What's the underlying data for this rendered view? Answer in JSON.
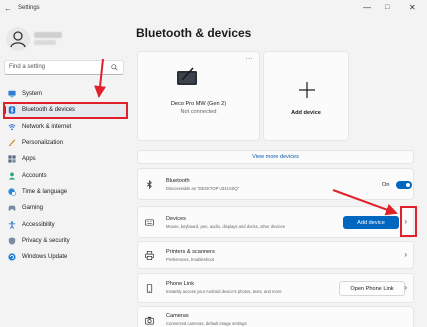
{
  "window": {
    "title": "Settings",
    "back_icon": "back-arrow-icon",
    "minimize": "—",
    "maximize": "□",
    "close": "✕"
  },
  "sidebar": {
    "search_placeholder": "Find a setting",
    "items": [
      {
        "label": "System",
        "icon": "monitor-icon",
        "color": "#2f7fd0"
      },
      {
        "label": "Bluetooth & devices",
        "icon": "bluetooth-icon",
        "color": "#1f6fd0",
        "active": true
      },
      {
        "label": "Network & internet",
        "icon": "wifi-icon",
        "color": "#2d6fcf"
      },
      {
        "label": "Personalization",
        "icon": "brush-icon",
        "color": "#e08a2c"
      },
      {
        "label": "Apps",
        "icon": "apps-icon",
        "color": "#5a6a80"
      },
      {
        "label": "Accounts",
        "icon": "person-icon",
        "color": "#2aa870"
      },
      {
        "label": "Time & language",
        "icon": "globe-clock-icon",
        "color": "#2a86d8"
      },
      {
        "label": "Gaming",
        "icon": "controller-icon",
        "color": "#7a8aa0"
      },
      {
        "label": "Accessibility",
        "icon": "accessibility-icon",
        "color": "#2a78d0"
      },
      {
        "label": "Privacy & security",
        "icon": "shield-icon",
        "color": "#7a8aa0"
      },
      {
        "label": "Windows Update",
        "icon": "update-icon",
        "color": "#1e80d8"
      }
    ]
  },
  "main": {
    "title": "Bluetooth & devices",
    "device": {
      "name": "Deco Pro MW (Gen 2)",
      "status": "Not connected",
      "more": "..."
    },
    "add_card": {
      "label": "Add device"
    },
    "view_more": "View more devices",
    "bluetooth": {
      "title": "Bluetooth",
      "subtitle": "Discoverable as \"DESKTOP-J341SSQ\"",
      "toggle_label": "On"
    },
    "devices": {
      "title": "Devices",
      "subtitle": "Mouse, keyboard, pen, audio, displays and docks, other devices",
      "button": "Add device"
    },
    "printers": {
      "title": "Printers & scanners",
      "subtitle": "Preferences, troubleshoot"
    },
    "phone": {
      "title": "Phone Link",
      "subtitle": "Instantly access your Android device's photos, texts, and more",
      "button": "Open Phone Link"
    },
    "cameras": {
      "title": "Cameras",
      "subtitle": "Connected cameras, default image settings"
    },
    "chevron": "›"
  },
  "colors": {
    "accent": "#0067c0",
    "highlight": "#e0202a"
  }
}
